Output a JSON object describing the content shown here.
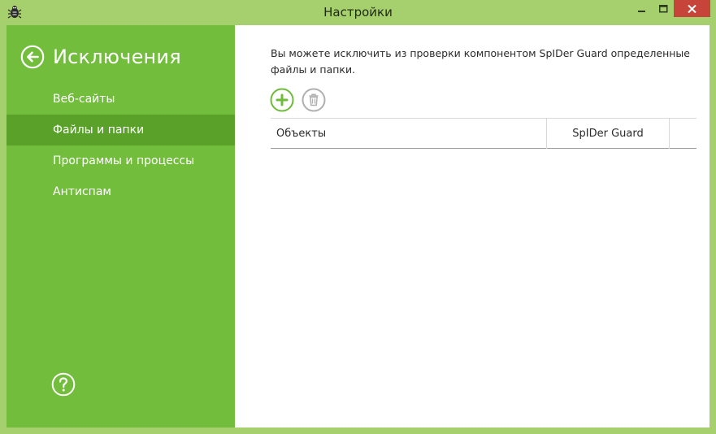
{
  "window": {
    "title": "Настройки"
  },
  "icons": {
    "app": "spider-bug-icon",
    "back": "arrow-left-circle-icon",
    "help": "question-circle-icon",
    "add": "plus-circle-icon",
    "delete": "trash-circle-icon",
    "minimize": "minimize-icon",
    "maximize": "maximize-icon",
    "close": "close-icon"
  },
  "colors": {
    "sidebar": "#72bd3b",
    "sidebar_active": "#5aa12a",
    "frame": "#a6cf6e",
    "close_button": "#c7443a",
    "accent_add": "#6fbb3a",
    "disabled_gray": "#b0b0b0"
  },
  "sidebar": {
    "section_title": "Исключения",
    "items": [
      {
        "label": "Веб-сайты",
        "active": false
      },
      {
        "label": "Файлы и папки",
        "active": true
      },
      {
        "label": "Программы и процессы",
        "active": false
      },
      {
        "label": "Антиспам",
        "active": false
      }
    ]
  },
  "main": {
    "description": "Вы можете исключить из проверки компонентом SpIDer Guard определенные файлы и папки.",
    "table": {
      "columns": [
        "Объекты",
        "SpIDer Guard"
      ],
      "rows": []
    }
  }
}
